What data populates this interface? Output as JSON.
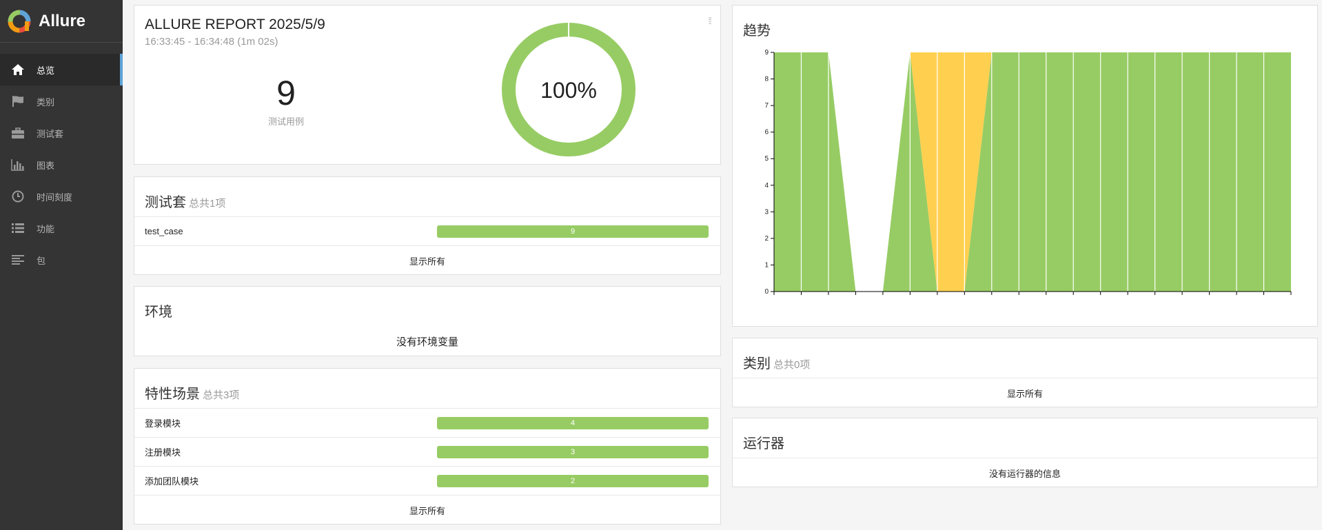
{
  "brand": {
    "name": "Allure"
  },
  "nav": [
    {
      "id": "overview",
      "label": "总览",
      "icon": "home-icon",
      "active": true
    },
    {
      "id": "categories",
      "label": "类别",
      "icon": "flag-icon"
    },
    {
      "id": "suites",
      "label": "测试套",
      "icon": "briefcase-icon"
    },
    {
      "id": "graphs",
      "label": "图表",
      "icon": "bar-chart-icon"
    },
    {
      "id": "timeline",
      "label": "时间刻度",
      "icon": "clock-icon"
    },
    {
      "id": "behaviors",
      "label": "功能",
      "icon": "list-icon"
    },
    {
      "id": "packages",
      "label": "包",
      "icon": "align-left-icon"
    }
  ],
  "summary": {
    "title": "ALLURE REPORT 2025/5/9",
    "time": "16:33:45 - 16:34:48 (1m 02s)",
    "count": "9",
    "count_label": "测试用例",
    "percent": "100%"
  },
  "suites": {
    "title": "测试套",
    "subtitle": "总共1项",
    "items": [
      {
        "label": "test_case",
        "count": "9"
      }
    ],
    "show_all": "显示所有"
  },
  "environment": {
    "title": "环境",
    "empty": "没有环境变量"
  },
  "features": {
    "title": "特性场景",
    "subtitle": "总共3项",
    "items": [
      {
        "label": "登录模块",
        "count": "4"
      },
      {
        "label": "注册模块",
        "count": "3"
      },
      {
        "label": "添加团队模块",
        "count": "2"
      }
    ],
    "show_all": "显示所有"
  },
  "trend": {
    "title": "趋势"
  },
  "categories": {
    "title": "类别",
    "subtitle": "总共0项",
    "show_all": "显示所有"
  },
  "executors": {
    "title": "运行器",
    "empty": "没有运行器的信息"
  },
  "colors": {
    "passed": "#97cc64",
    "broken": "#ffd050",
    "sidebar": "#343434",
    "accent": "#5fa3d8"
  },
  "chart_data": {
    "type": "area",
    "title": "趋势",
    "y_ticks": [
      "0",
      "1",
      "2",
      "3",
      "4",
      "5",
      "6",
      "7",
      "8",
      "9"
    ],
    "ylim": [
      0,
      9
    ],
    "x": [
      0,
      1,
      2,
      3,
      4,
      5,
      6,
      7,
      8,
      9,
      10,
      11,
      12,
      13,
      14,
      15,
      16,
      17,
      18,
      19
    ],
    "series": [
      {
        "color": "#97cc64",
        "values": [
          9,
          9,
          9,
          0,
          0,
          9,
          0,
          0,
          9,
          9,
          9,
          9,
          9,
          9,
          9,
          9,
          9,
          9,
          9,
          9
        ]
      },
      {
        "color": "#ffd050",
        "values": [
          0,
          0,
          0,
          0,
          0,
          0,
          9,
          9,
          0,
          0,
          0,
          0,
          0,
          0,
          0,
          0,
          0,
          0,
          0,
          0
        ]
      }
    ]
  }
}
